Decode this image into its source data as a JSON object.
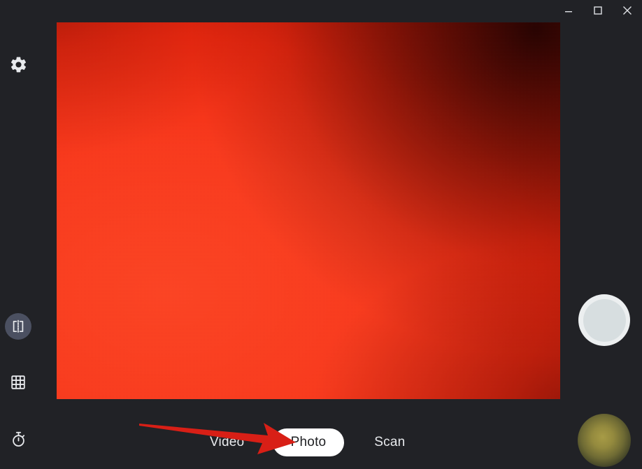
{
  "window": {
    "controls": [
      {
        "name": "minimize",
        "icon": "minimize-icon",
        "label": "Minimize"
      },
      {
        "name": "maximize",
        "icon": "maximize-icon",
        "label": "Maximize"
      },
      {
        "name": "close",
        "icon": "close-icon",
        "label": "Close"
      }
    ]
  },
  "colors": {
    "app_background": "#212226",
    "preview_red": "#f6301a",
    "preview_dark_red": "#8e1405",
    "accent_active": "#4b5061",
    "selected_pill": "#ffffff",
    "selected_pill_text": "#202124",
    "text": "#e8eaed",
    "annotation_arrow": "#d81f16",
    "thumbnail_glow": "#a79b46",
    "shutter_outer": "#eceff0",
    "shutter_inner": "#d7dee0"
  },
  "left_rail": {
    "items": [
      {
        "id": "settings",
        "icon": "gear-icon",
        "label": "Settings",
        "active": false
      },
      {
        "id": "mirror",
        "icon": "mirror-icon",
        "label": "Mirroring",
        "active": true
      },
      {
        "id": "grid",
        "icon": "grid-icon",
        "label": "Grid",
        "active": false
      },
      {
        "id": "timer",
        "icon": "timer-icon",
        "label": "Timer",
        "active": false
      }
    ]
  },
  "right_rail": {
    "shutter": {
      "icon": "shutter-button-icon",
      "label": "Take photo"
    },
    "thumbnail": {
      "icon": "gallery-thumbnail",
      "label": "Last captured photo"
    }
  },
  "preview": {
    "label": "Camera preview"
  },
  "mode_bar": {
    "modes": [
      {
        "id": "video",
        "label": "Video",
        "selected": false
      },
      {
        "id": "photo",
        "label": "Photo",
        "selected": true
      },
      {
        "id": "scan",
        "label": "Scan",
        "selected": false
      }
    ]
  },
  "annotation": {
    "arrow": {
      "label": "Arrow pointing at Photo mode",
      "color": "#d81f16"
    }
  }
}
